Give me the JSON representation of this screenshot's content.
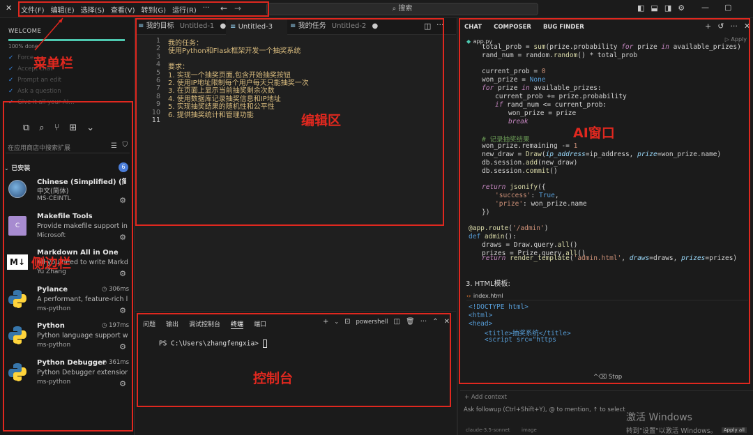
{
  "titlebar": {
    "menu": [
      "文件(F)",
      "编辑(E)",
      "选择(S)",
      "查看(V)",
      "转到(G)",
      "运行(R)",
      "···"
    ],
    "search_label": "搜索",
    "back_glyph": "←",
    "fwd_glyph": "→"
  },
  "sidebar": {
    "welcome_title": "WELCOME",
    "progress_text": "100% done",
    "progress_pct": 100,
    "checklist": [
      "Force…",
      "Accept chat",
      "Prompt an edit",
      "Ask a question",
      "Give it all your AI…"
    ],
    "search_placeholder": "在应用商店中搜索扩展",
    "installed_label": "已安装",
    "installed_count": "6",
    "extensions": [
      {
        "name": "Chinese (Simplified) (简体…",
        "desc": "中文(简体)",
        "publisher": "MS-CEINTL",
        "time": "",
        "icon": "globe-icon",
        "color": "#2b4d7a"
      },
      {
        "name": "Makefile Tools",
        "desc": "Provide makefile support in V…",
        "publisher": "Microsoft",
        "time": "",
        "icon": "makefile-icon",
        "color": "#8a5bb5"
      },
      {
        "name": "Markdown All in One",
        "desc": "All you need to write Markdo…",
        "publisher": "Yu Zhang",
        "time": "",
        "icon": "markdown-icon",
        "color": "#ffffff"
      },
      {
        "name": "Pylance",
        "desc": "A performant, feature-rich la…",
        "publisher": "ms-python",
        "time": "306ms",
        "icon": "python-icon",
        "color": "#3776ab"
      },
      {
        "name": "Python",
        "desc": "Python language support wit…",
        "publisher": "ms-python",
        "time": "197ms",
        "icon": "python-icon",
        "color": "#3776ab"
      },
      {
        "name": "Python Debugger",
        "desc": "Python Debugger extension …",
        "publisher": "ms-python",
        "time": "361ms",
        "icon": "python-icon",
        "color": "#3776ab"
      }
    ]
  },
  "editor": {
    "tabs": [
      {
        "label": "我的目标",
        "sub": "Untitled-1",
        "dirty": true
      },
      {
        "label": "Untitled-3",
        "sub": "",
        "dirty": false
      },
      {
        "label": "我的任务",
        "sub": "Untitled-2",
        "dirty": true
      }
    ],
    "lines": [
      "我的任务：",
      "使用Python和Flask框架开发一个抽奖系统",
      "",
      "要求：",
      "1. 实现一个抽奖页面,包含开始抽奖按钮",
      "2. 使用IP地址限制每个用户每天只能抽奖一次",
      "3. 在页面上显示当前抽奖剩余次数",
      "4. 使用数据库记录抽奖信息和IP地址",
      "5. 实现抽奖结果的随机性和公平性",
      "6. 提供抽奖统计和管理功能",
      ""
    ]
  },
  "panel": {
    "tabs": [
      "问题",
      "输出",
      "调试控制台",
      "终端",
      "端口"
    ],
    "active_tab": "终端",
    "shell": "powershell",
    "prompt": "PS C:\\Users\\zhangfengxia> "
  },
  "ai": {
    "tabs": [
      "CHAT",
      "COMPOSER",
      "BUG FINDER"
    ],
    "file": "app.py",
    "apply_label": "Apply",
    "section_label": "3. HTML模板:",
    "file2": "index.html",
    "html_lines": [
      "<!DOCTYPE html>",
      "<html>",
      "<head>",
      "    <title>抽奖系统</title>",
      "    <script src=\"https"
    ],
    "stop_label": "Stop",
    "add_context": "+ Add context",
    "input_placeholder": "Ask followup (Ctrl+Shift+Y), @ to mention, ↑ to select",
    "model": "claude-3.5-sonnet",
    "image_label": "image",
    "apply_all": "Apply all"
  },
  "annotations": {
    "menubar": "菜单栏",
    "sidebar": "侧边栏",
    "editor": "编辑区",
    "console": "控制台",
    "ai": "AI窗口"
  },
  "watermark": {
    "title": "激活 Windows",
    "sub": "转到\"设置\"以激活 Windows。"
  }
}
